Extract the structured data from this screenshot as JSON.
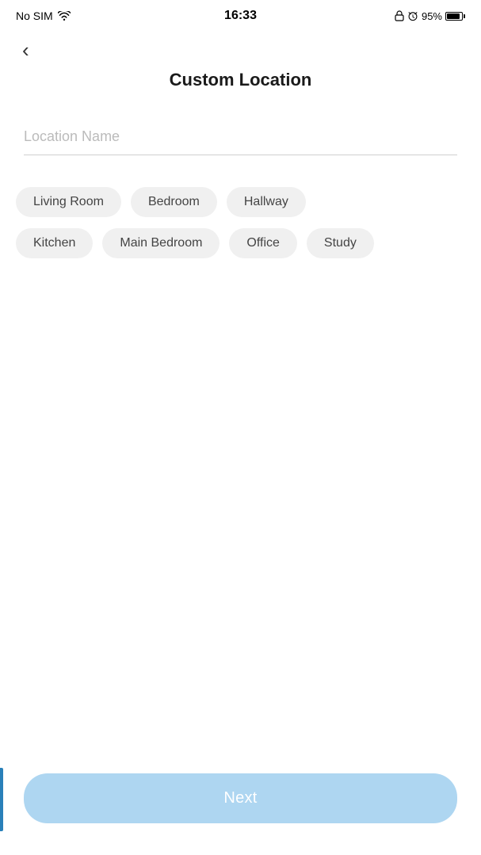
{
  "status_bar": {
    "carrier": "No SIM",
    "time": "16:33",
    "battery_pct": "95%"
  },
  "page": {
    "title": "Custom Location",
    "back_label": "‹"
  },
  "input": {
    "placeholder": "Location Name",
    "value": ""
  },
  "chips": {
    "row1": [
      {
        "label": "Living Room"
      },
      {
        "label": "Bedroom"
      },
      {
        "label": "Hallway"
      }
    ],
    "row2": [
      {
        "label": "Kitchen"
      },
      {
        "label": "Main Bedroom"
      },
      {
        "label": "Office"
      },
      {
        "label": "Study"
      }
    ]
  },
  "footer": {
    "next_label": "Next"
  }
}
